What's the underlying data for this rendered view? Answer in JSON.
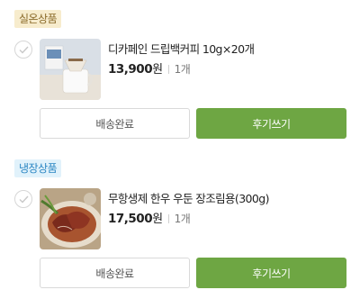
{
  "orders": [
    {
      "category": "실온상품",
      "product_name": "디카페인 드립백커피 10g×20개",
      "price": "13,900",
      "price_unit": "원",
      "quantity": "1개",
      "left_button": "배송완료",
      "right_button": "후기쓰기"
    },
    {
      "category": "냉장상품",
      "product_name": "무항생제 한우 우둔 장조림용(300g)",
      "price": "17,500",
      "price_unit": "원",
      "quantity": "1개",
      "left_button": "배송완료",
      "right_button": "후기쓰기"
    }
  ],
  "colors": {
    "accent_green": "#6ea643",
    "room_badge_bg": "#f7eccd",
    "cold_badge_bg": "#e1f2fb"
  }
}
